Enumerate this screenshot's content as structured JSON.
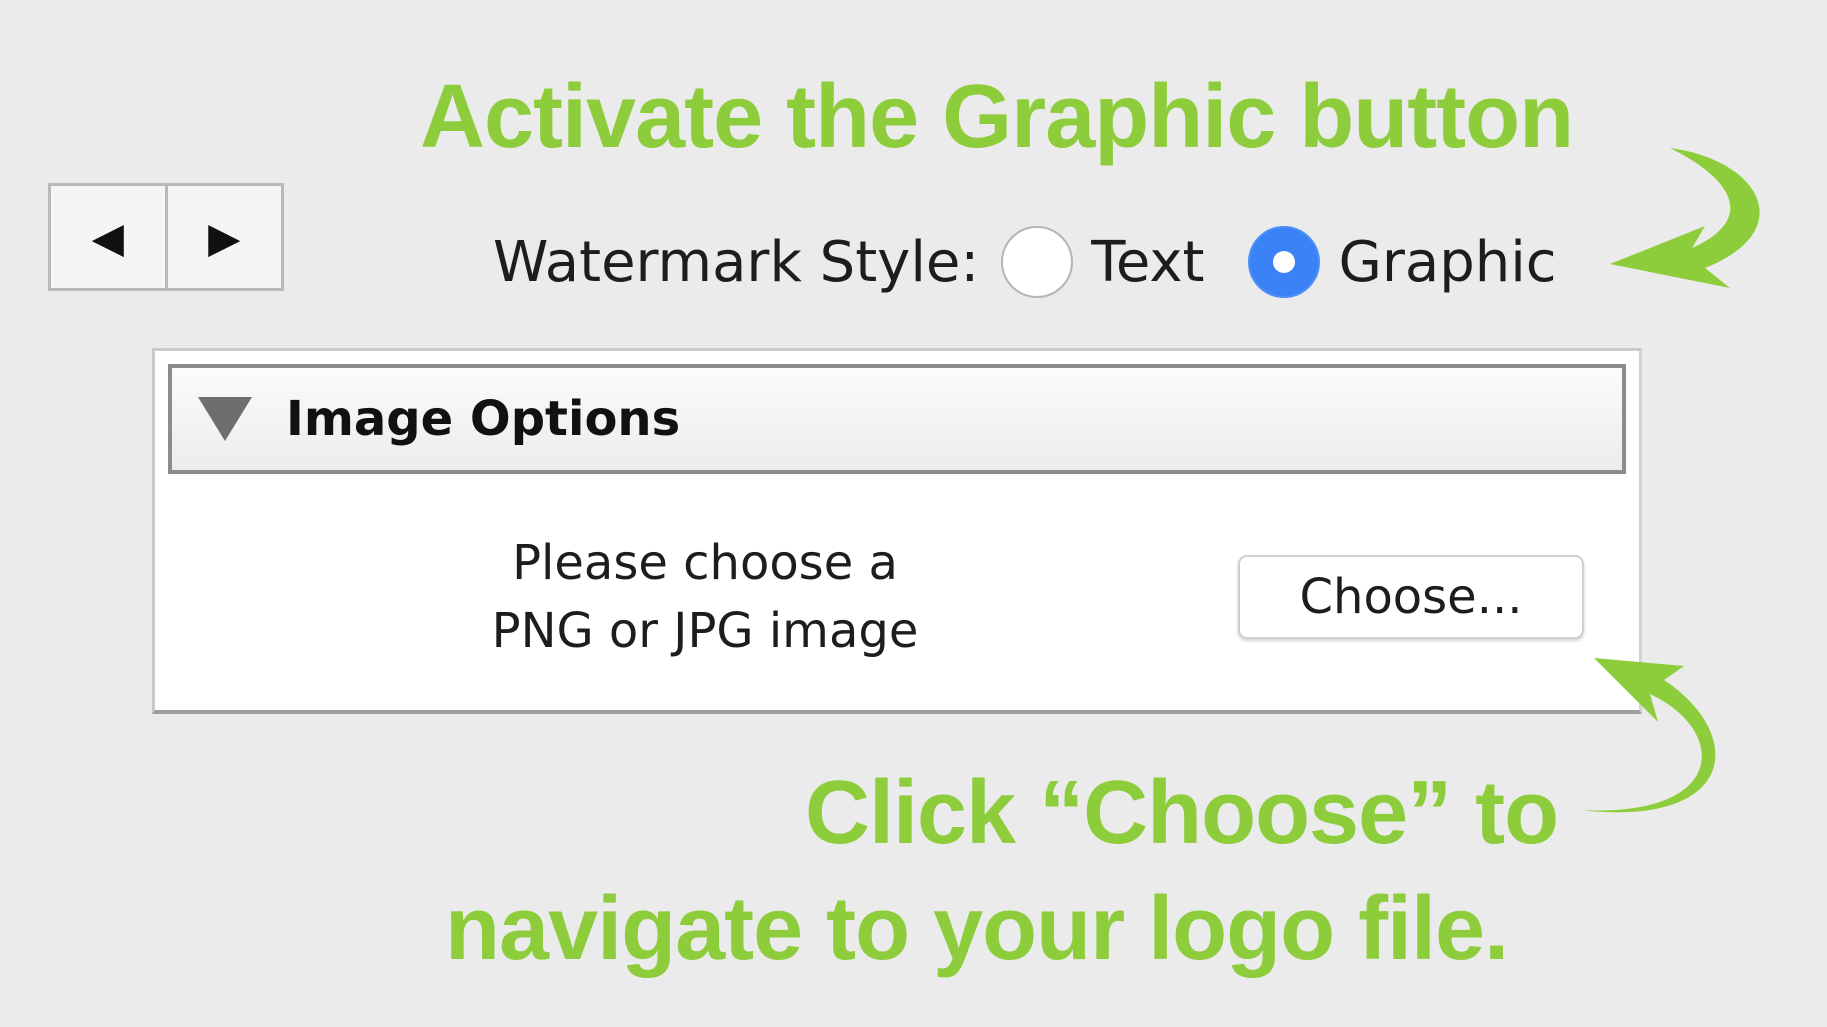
{
  "callouts": {
    "top": "Activate the Graphic button",
    "bottom_line1": "Click “Choose” to",
    "bottom_line2": "navigate to your logo file."
  },
  "nav": {
    "back_glyph": "◀",
    "forward_glyph": "▶"
  },
  "watermark_style": {
    "label": "Watermark Style:",
    "options": [
      {
        "label": "Text",
        "selected": false
      },
      {
        "label": "Graphic",
        "selected": true
      }
    ]
  },
  "image_options": {
    "title": "Image Options",
    "expanded": true,
    "prompt_line1": "Please choose a",
    "prompt_line2": "PNG or JPG image",
    "choose_button": "Choose..."
  },
  "colors": {
    "callout_green": "#8dcc3a",
    "radio_selected": "#3b82f6",
    "background": "#ebebeb"
  }
}
